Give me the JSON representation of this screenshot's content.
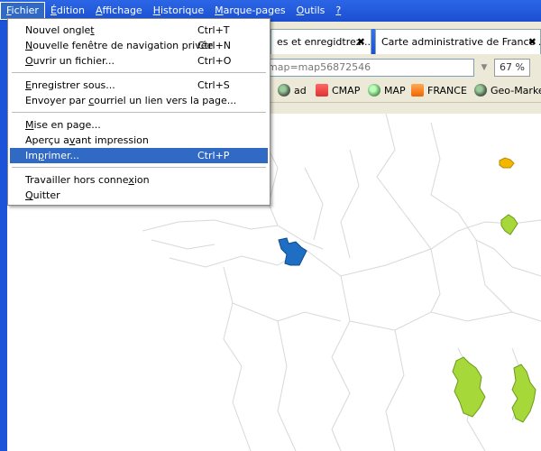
{
  "menubar": {
    "items": [
      {
        "label": "Fichier",
        "accel": "F",
        "rest": "ichier"
      },
      {
        "label": "Édition",
        "accel": "É",
        "rest": "dition"
      },
      {
        "label": "Affichage",
        "accel": "A",
        "rest": "ffichage"
      },
      {
        "label": "Historique",
        "accel": "H",
        "rest": "istorique"
      },
      {
        "label": "Marque-pages",
        "accel": "M",
        "rest": "arque-pages"
      },
      {
        "label": "Outils",
        "accel": "O",
        "rest": "utils"
      },
      {
        "label": "?",
        "accel": "?",
        "rest": ""
      }
    ]
  },
  "tabs": [
    {
      "label": "es et enregidtrez...",
      "close": "✖"
    },
    {
      "label": "Carte administrative de France ...",
      "close": "✖"
    }
  ],
  "navbar": {
    "url": "map=map56872546",
    "dropmarker": "▼",
    "zoom": "67 %"
  },
  "bookmarks": [
    {
      "label": "ad",
      "icon": "globe-icon"
    },
    {
      "label": "CMAP",
      "icon": "cmap-icon"
    },
    {
      "label": "MAP",
      "icon": "map-icon"
    },
    {
      "label": "FRANCE",
      "icon": "france-icon"
    },
    {
      "label": "Geo-Market",
      "icon": "globe-icon"
    }
  ],
  "file_menu": {
    "items": [
      {
        "pre": "Nouvel ongle",
        "acc": "t",
        "post": "",
        "shortcut": "Ctrl+T"
      },
      {
        "pre": "",
        "acc": "N",
        "post": "ouvelle fenêtre de navigation privée",
        "shortcut": "Ctrl+N"
      },
      {
        "pre": "",
        "acc": "O",
        "post": "uvrir un fichier...",
        "shortcut": "Ctrl+O"
      },
      {
        "pre": "",
        "acc": "E",
        "post": "nregistrer sous...",
        "shortcut": "Ctrl+S"
      },
      {
        "pre": "Envoyer par ",
        "acc": "c",
        "post": "ourriel un lien vers la page...",
        "shortcut": ""
      },
      {
        "pre": "",
        "acc": "M",
        "post": "ise en page...",
        "shortcut": ""
      },
      {
        "pre": "Aperçu a",
        "acc": "v",
        "post": "ant impression",
        "shortcut": ""
      },
      {
        "pre": "Im",
        "acc": "p",
        "post": "rimer...",
        "shortcut": "Ctrl+P"
      },
      {
        "pre": "Travailler hors conne",
        "acc": "x",
        "post": "ion",
        "shortcut": ""
      },
      {
        "pre": "",
        "acc": "Q",
        "post": "uitter",
        "shortcut": ""
      }
    ]
  },
  "colors": {
    "menubar": "#1c54d9",
    "highlight": "#316ac5",
    "region_blue": "#1e6fc4",
    "region_green": "#a6d83a",
    "region_yellow": "#f2b800"
  }
}
